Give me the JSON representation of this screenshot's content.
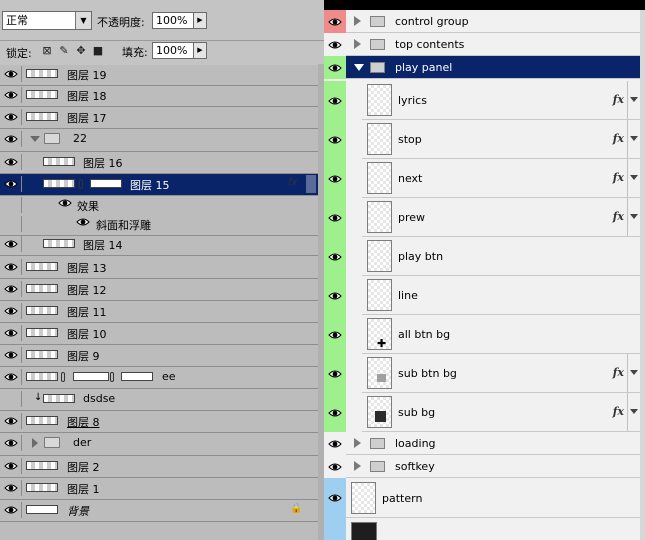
{
  "left_panel": {
    "blend_mode": "正常",
    "opacity_label": "不透明度:",
    "opacity_value": "100%",
    "lock_label": "锁定:",
    "fill_label": "填充:",
    "fill_value": "100%",
    "layers": [
      {
        "name": "图层 19"
      },
      {
        "name": "图层 18"
      },
      {
        "name": "图层 17"
      },
      {
        "name": "22"
      },
      {
        "name": "图层 16"
      },
      {
        "name": "图层 15"
      },
      {
        "name": "效果"
      },
      {
        "name": "斜面和浮雕"
      },
      {
        "name": "图层 14"
      },
      {
        "name": "图层 13"
      },
      {
        "name": "图层 12"
      },
      {
        "name": "图层 11"
      },
      {
        "name": "图层 10"
      },
      {
        "name": "图层 9"
      },
      {
        "name": "ee"
      },
      {
        "name": "dsdse"
      },
      {
        "name": "图层 8"
      },
      {
        "name": "der"
      },
      {
        "name": "图层 2"
      },
      {
        "name": "图层 1"
      },
      {
        "name": "背景"
      }
    ]
  },
  "right_panel": {
    "groups_top": [
      {
        "name": "control group"
      },
      {
        "name": "top contents"
      },
      {
        "name": "play panel"
      }
    ],
    "children": [
      {
        "name": "lyrics",
        "fx": "fx"
      },
      {
        "name": "stop",
        "fx": "fx"
      },
      {
        "name": "next",
        "fx": "fx"
      },
      {
        "name": "prew",
        "fx": "fx"
      },
      {
        "name": "play btn"
      },
      {
        "name": "line"
      },
      {
        "name": "all btn bg"
      },
      {
        "name": "sub btn bg",
        "fx": "fx"
      },
      {
        "name": "sub bg",
        "fx": "fx"
      }
    ],
    "groups_bottom": [
      {
        "name": "loading"
      },
      {
        "name": "softkey"
      }
    ],
    "pattern": {
      "name": "pattern"
    }
  },
  "colors": {
    "selected": "#0a246a",
    "eye_red": "#f08b8b",
    "eye_green": "#9ef08c",
    "eye_blue": "#9ecff0"
  }
}
